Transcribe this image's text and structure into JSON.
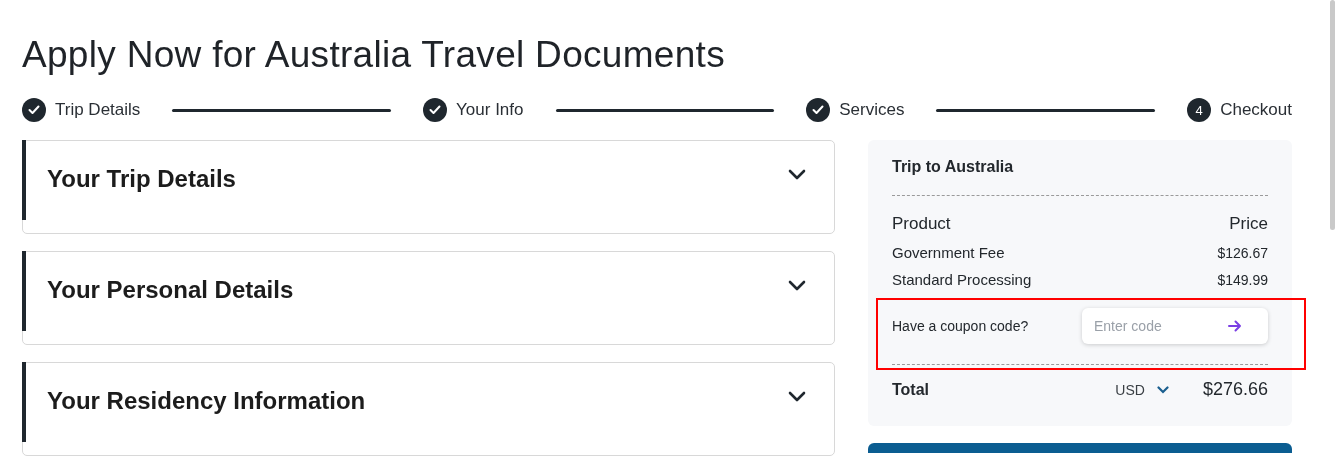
{
  "title": "Apply Now for Australia Travel Documents",
  "steps": [
    {
      "label": "Trip Details",
      "done": true
    },
    {
      "label": "Your Info",
      "done": true
    },
    {
      "label": "Services",
      "done": true
    },
    {
      "label": "Checkout",
      "done": false,
      "number": "4"
    }
  ],
  "sections": [
    {
      "title": "Your Trip Details",
      "expanded": false
    },
    {
      "title": "Your Personal Details",
      "expanded": false
    },
    {
      "title": "Your Residency Information",
      "expanded": false
    }
  ],
  "summary": {
    "title": "Trip to Australia",
    "columns": [
      "Product",
      "Price"
    ],
    "items": [
      {
        "name": "Government Fee",
        "price": "$126.67"
      },
      {
        "name": "Standard Processing",
        "price": "$149.99"
      }
    ],
    "coupon": {
      "label": "Have a coupon code?",
      "placeholder": "Enter code",
      "highlighted": true
    },
    "total": {
      "label": "Total",
      "currency": "USD",
      "amount": "$276.66"
    }
  }
}
